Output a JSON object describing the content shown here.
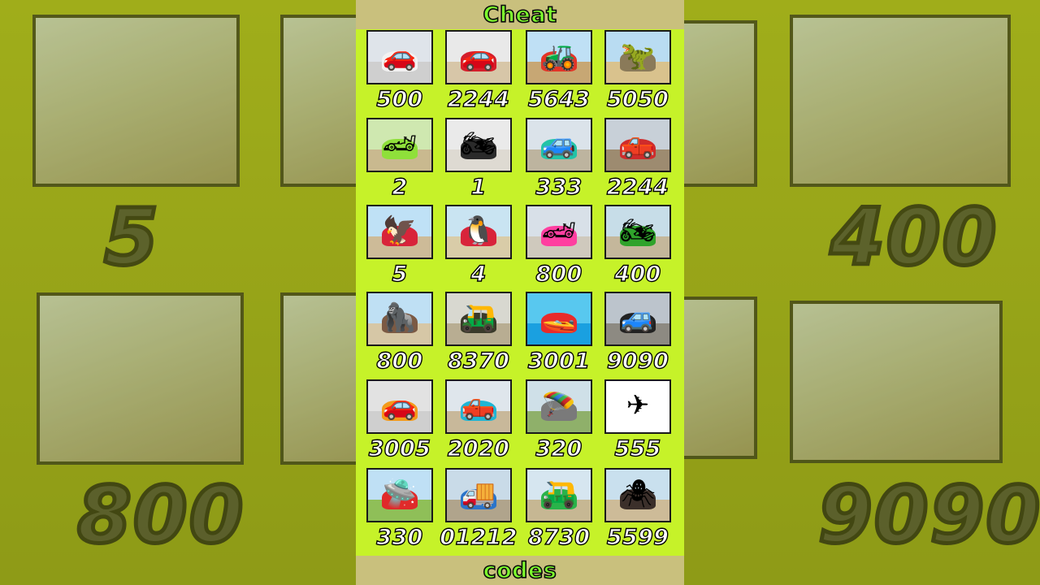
{
  "header": {
    "title": "Cheat"
  },
  "footer": {
    "title": "codes"
  },
  "colors": {
    "panel": "#c6f229",
    "banner": "#c9c07d",
    "banner_text": "#7dff2d",
    "code_text": "#ffffff"
  },
  "items": [
    {
      "code": "500",
      "icon": "white-sports-car-icon",
      "sky": "#dfe4ea",
      "ground": "#cfcfcf",
      "shape": "#f2f2f2",
      "glyph": "🚗"
    },
    {
      "code": "2244",
      "icon": "red-sports-car-icon",
      "sky": "#e9e9e9",
      "ground": "#d7c6a8",
      "shape": "#d51d2a",
      "glyph": "🚗"
    },
    {
      "code": "5643",
      "icon": "tractor-icon",
      "sky": "#bfe0f5",
      "ground": "#c7a774",
      "shape": "#e33427",
      "glyph": "🚜"
    },
    {
      "code": "5050",
      "icon": "raptor-dinosaur-icon",
      "sky": "#b9dcf2",
      "ground": "#d9c28d",
      "shape": "#8a7a59",
      "glyph": "🦖"
    },
    {
      "code": "2",
      "icon": "green-supercar-icon",
      "sky": "#cfe8b0",
      "ground": "#c9b98f",
      "shape": "#8fe03a",
      "glyph": "🏎"
    },
    {
      "code": "1",
      "icon": "black-motorcycle-icon",
      "sky": "#eaeaea",
      "ground": "#dedad2",
      "shape": "#2a2a2a",
      "glyph": "🏍"
    },
    {
      "code": "333",
      "icon": "colorful-suv-icon",
      "sky": "#dbe3ea",
      "ground": "#bdb49f",
      "shape": "#22c3a8",
      "glyph": "🚙"
    },
    {
      "code": "2244",
      "icon": "monster-truck-icon",
      "sky": "#c8d0d8",
      "ground": "#9d8b70",
      "shape": "#cf2b2b",
      "glyph": "🛻"
    },
    {
      "code": "5",
      "icon": "eagle-character-icon",
      "sky": "#bfe1f6",
      "ground": "#cdbb98",
      "shape": "#d8243a",
      "glyph": "🦅"
    },
    {
      "code": "4",
      "icon": "penguins-character-icon",
      "sky": "#c9e4f2",
      "ground": "#d9cca8",
      "shape": "#d8243a",
      "glyph": "🐧"
    },
    {
      "code": "800",
      "icon": "rainbow-car-icon",
      "sky": "#d8e0e8",
      "ground": "#cfc9bd",
      "shape": "#ff3fa0",
      "glyph": "🏎"
    },
    {
      "code": "400",
      "icon": "green-sportbikes-icon",
      "sky": "#c7dde8",
      "ground": "#c4b79b",
      "shape": "#2fa32b",
      "glyph": "🏍"
    },
    {
      "code": "800",
      "icon": "gorilla-monster-icon",
      "sky": "#bfe0f4",
      "ground": "#d6c7a6",
      "shape": "#7b5a44",
      "glyph": "🦍"
    },
    {
      "code": "8370",
      "icon": "auto-rickshaw-icon",
      "sky": "#d8d8d0",
      "ground": "#b8ad92",
      "shape": "#3a3a2a",
      "glyph": "🛺"
    },
    {
      "code": "3001",
      "icon": "speedboat-icon",
      "sky": "#58c8ef",
      "ground": "#1aa0e0",
      "shape": "#e82b2b",
      "glyph": "🚤"
    },
    {
      "code": "9090",
      "icon": "black-jeep-icon",
      "sky": "#bcc4cc",
      "ground": "#8d8a82",
      "shape": "#222222",
      "glyph": "🚙"
    },
    {
      "code": "3005",
      "icon": "orange-gtr-car-icon",
      "sky": "#e2e2e2",
      "ground": "#cfcfcf",
      "shape": "#f39a1a",
      "glyph": "🚗"
    },
    {
      "code": "2020",
      "icon": "blue-pickup-truck-icon",
      "sky": "#dfe6ec",
      "ground": "#c8b89a",
      "shape": "#1fb5d4",
      "glyph": "🛻"
    },
    {
      "code": "320",
      "icon": "jetpack-icon",
      "sky": "#cfe0e8",
      "ground": "#8fb06a",
      "shape": "#7a7a7a",
      "glyph": "🪂"
    },
    {
      "code": "555",
      "icon": "airplane-icon",
      "sky": "#ffffff",
      "ground": "#ffffff",
      "shape": "#ffffff",
      "glyph": "✈"
    },
    {
      "code": "330",
      "icon": "red-hover-drone-icon",
      "sky": "#bfe0f5",
      "ground": "#8fbf58",
      "shape": "#e02a2a",
      "glyph": "🛸"
    },
    {
      "code": "01212",
      "icon": "cargo-truck-icon",
      "sky": "#c9dbe8",
      "ground": "#b0a48c",
      "shape": "#2b74c9",
      "glyph": "🚚"
    },
    {
      "code": "8730",
      "icon": "green-rickshaw-icon",
      "sky": "#d6e6f0",
      "ground": "#c6b793",
      "shape": "#29b34a",
      "glyph": "🛺"
    },
    {
      "code": "5599",
      "icon": "spider-monster-icon",
      "sky": "#c9e0ee",
      "ground": "#cdbb98",
      "shape": "#3b2f2a",
      "glyph": "🕷"
    }
  ],
  "background": {
    "left_codes": [
      "5",
      "800"
    ],
    "right_codes": [
      "400",
      "9090"
    ]
  }
}
